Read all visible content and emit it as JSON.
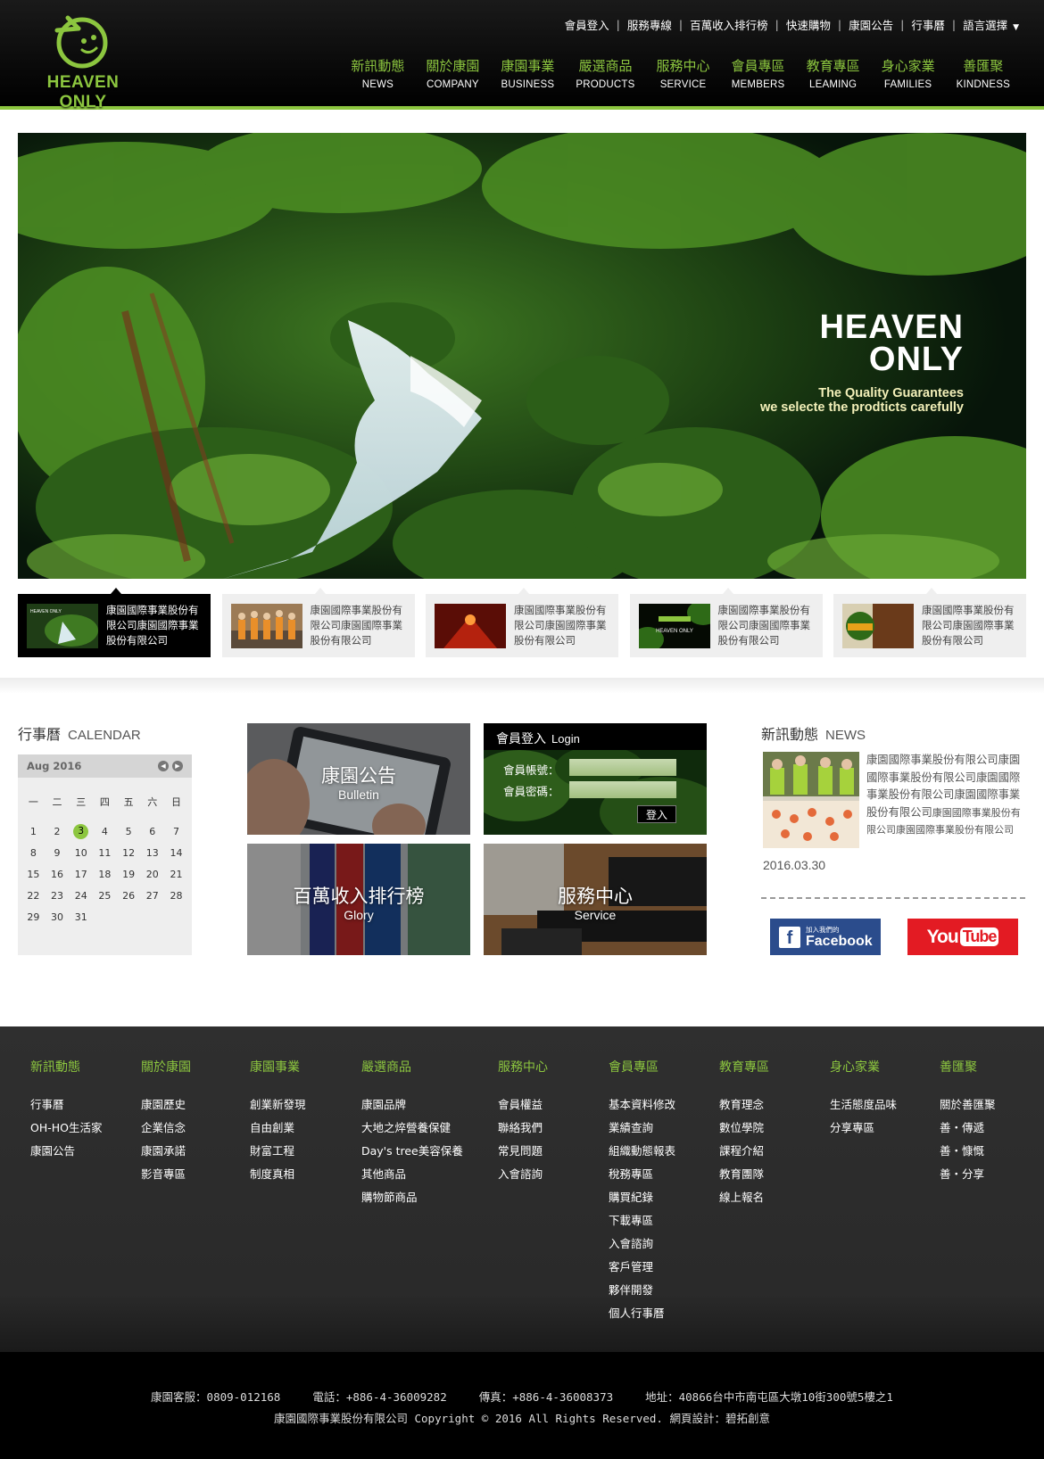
{
  "brand": {
    "name": "HEAVEN ONLY",
    "accent": "#8cc63f"
  },
  "topbar": [
    "會員登入",
    "服務專線",
    "百萬收入排行榜",
    "快速購物",
    "康園公告",
    "行事曆",
    "語言選擇"
  ],
  "nav": [
    {
      "zh": "新訊動態",
      "en": "NEWS"
    },
    {
      "zh": "關於康園",
      "en": "COMPANY"
    },
    {
      "zh": "康園事業",
      "en": "BUSINESS"
    },
    {
      "zh": "嚴選商品",
      "en": "PRODUCTS"
    },
    {
      "zh": "服務中心",
      "en": "SERVICE"
    },
    {
      "zh": "會員專區",
      "en": "MEMBERS"
    },
    {
      "zh": "教育專區",
      "en": "LEAMING"
    },
    {
      "zh": "身心家業",
      "en": "FAMILIES"
    },
    {
      "zh": "善匯聚",
      "en": "KINDNESS"
    }
  ],
  "hero": {
    "title_line1": "HEAVEN",
    "title_line2": "ONLY",
    "sub1": "The Quality Guarantees",
    "sub2": "we selecte the prodticts carefully"
  },
  "thumbs": [
    {
      "text": "康園國際事業股份有限公司康園國際事業股份有限公司",
      "active": true,
      "img_label": "HEAVEN ONLY"
    },
    {
      "text": "康園國際事業股份有限公司康園國際事業股份有限公司",
      "active": false
    },
    {
      "text": "康園國際事業股份有限公司康園國際事業股份有限公司",
      "active": false
    },
    {
      "text": "康園國際事業股份有限公司康園國際事業股份有限公司",
      "active": false,
      "img_label": "HEAVEN ONLY"
    },
    {
      "text": "康園國際事業股份有限公司康園國際事業股份有限公司",
      "active": false
    }
  ],
  "calendar": {
    "title": "行事曆",
    "title_en": "CALENDAR",
    "month": "Aug 2016",
    "weekdays": [
      "一",
      "二",
      "三",
      "四",
      "五",
      "六",
      "日"
    ],
    "weeks": [
      [
        "1",
        "2",
        "3",
        "4",
        "5",
        "6",
        "7"
      ],
      [
        "8",
        "9",
        "10",
        "11",
        "12",
        "13",
        "14"
      ],
      [
        "15",
        "16",
        "17",
        "18",
        "19",
        "20",
        "21"
      ],
      [
        "22",
        "23",
        "24",
        "25",
        "26",
        "27",
        "28"
      ],
      [
        "29",
        "30",
        "31",
        "",
        "",
        "",
        ""
      ]
    ],
    "today": "3"
  },
  "tiles": {
    "bulletin": {
      "zh": "康園公告",
      "en": "Bulletin"
    },
    "glory": {
      "zh": "百萬收入排行榜",
      "en": "Glory"
    },
    "service": {
      "zh": "服務中心",
      "en": "Service"
    }
  },
  "login": {
    "title": "會員登入",
    "title_en": "Login",
    "account_label": "會員帳號：",
    "password_label": "會員密碼：",
    "submit": "登入"
  },
  "news": {
    "title": "新訊動態",
    "title_en": "NEWS",
    "text_main": "康園國際事業股份有限公司康園國際事業股份有限公司康園國際事業股份有限公司康園國際事業股份有限公司",
    "text_small": "康園國際事業股份有限公司康園國際事業股份有限公司",
    "date": "2016.03.30"
  },
  "social": {
    "fb_small": "加入我們的",
    "fb_big": "Facebook",
    "yt_you": "You",
    "yt_tube": "Tube"
  },
  "footer_nav": [
    {
      "head": "新訊動態",
      "items": [
        "行事曆",
        "OH-HO生活家",
        "康園公告"
      ]
    },
    {
      "head": "關於康園",
      "items": [
        "康園歷史",
        "企業信念",
        "康園承諾",
        "影音專區"
      ]
    },
    {
      "head": "康園事業",
      "items": [
        "創業新發現",
        "自由創業",
        "財富工程",
        "制度真相"
      ]
    },
    {
      "head": "嚴選商品",
      "items": [
        "康園品牌",
        "大地之焠營養保健",
        "Day's tree美容保養",
        "其他商品",
        "購物節商品"
      ]
    },
    {
      "head": "服務中心",
      "items": [
        "會員權益",
        "聯絡我們",
        "常見問題",
        "入會諮詢"
      ]
    },
    {
      "head": "會員專區",
      "items": [
        "基本資料修改",
        "業績查詢",
        "組織動態報表",
        "稅務專區",
        "購買紀錄",
        "下載專區",
        "入會諮詢",
        "客戶管理",
        "夥伴開發",
        "個人行事曆"
      ]
    },
    {
      "head": "教育專區",
      "items": [
        "教育理念",
        "數位學院",
        "課程介紹",
        "教育團隊",
        "線上報名"
      ]
    },
    {
      "head": "身心家業",
      "items": [
        "生活態度品味",
        "分享專區"
      ]
    },
    {
      "head": "善匯聚",
      "items": [
        "關於善匯聚",
        "善・傳遞",
        "善・慷慨",
        "善・分享"
      ]
    }
  ],
  "copyright": {
    "hotline": "康園客服：0809-012168",
    "phone": "電話：+886-4-36009282",
    "fax": "傳真：+886-4-36008373",
    "address": "地址：40866台中市南屯區大墩10街300號5樓之1",
    "line2": "康園國際事業股份有限公司 Copyright © 2016 All Rights Reserved. 網頁設計：碧拓創意"
  }
}
